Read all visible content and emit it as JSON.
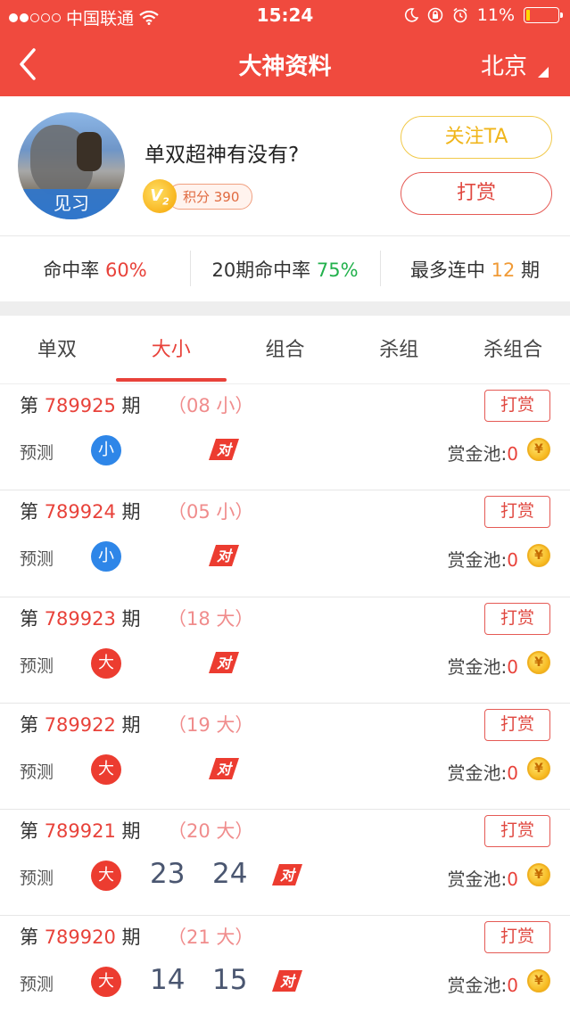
{
  "status_bar": {
    "carrier": "中国联通",
    "time": "15:24",
    "battery": "11%",
    "battery_level": 0.11
  },
  "nav": {
    "title": "大神资料",
    "city": "北京"
  },
  "profile": {
    "level_label": "见习",
    "name": "单双超神有没有?",
    "badge_level": "V",
    "badge_sub": "2",
    "score": "积分 390",
    "follow_label": "关注TA",
    "tip_label": "打赏"
  },
  "stats": [
    {
      "label": "命中率 ",
      "value": "60%",
      "color": "#e8423a"
    },
    {
      "label": "20期命中率 ",
      "value": "75%",
      "color": "#22b14c"
    },
    {
      "label": "最多连中 ",
      "value": "12",
      "suffix": " 期",
      "color": "#f09a35"
    }
  ],
  "tabs": [
    {
      "label": "单双",
      "active": false
    },
    {
      "label": "大小",
      "active": true
    },
    {
      "label": "组合",
      "active": false
    },
    {
      "label": "杀组",
      "active": false
    },
    {
      "label": "杀组合",
      "active": false
    }
  ],
  "rows": [
    {
      "prefix": "第 ",
      "issue": "789925",
      "suffix": " 期",
      "result": "（08   小）",
      "tip": "打赏",
      "pred_label": "预测",
      "ball": "小",
      "ball_color": "blue",
      "nums": [],
      "verdict": "对",
      "pool_label": "赏金池:",
      "pool_value": "0"
    },
    {
      "prefix": "第 ",
      "issue": "789924",
      "suffix": " 期",
      "result": "（05   小）",
      "tip": "打赏",
      "pred_label": "预测",
      "ball": "小",
      "ball_color": "blue",
      "nums": [],
      "verdict": "对",
      "pool_label": "赏金池:",
      "pool_value": "0"
    },
    {
      "prefix": "第 ",
      "issue": "789923",
      "suffix": " 期",
      "result": "（18   大）",
      "tip": "打赏",
      "pred_label": "预测",
      "ball": "大",
      "ball_color": "red",
      "nums": [],
      "verdict": "对",
      "pool_label": "赏金池:",
      "pool_value": "0"
    },
    {
      "prefix": "第 ",
      "issue": "789922",
      "suffix": " 期",
      "result": "（19   大）",
      "tip": "打赏",
      "pred_label": "预测",
      "ball": "大",
      "ball_color": "red",
      "nums": [],
      "verdict": "对",
      "pool_label": "赏金池:",
      "pool_value": "0"
    },
    {
      "prefix": "第 ",
      "issue": "789921",
      "suffix": " 期",
      "result": "（20   大）",
      "tip": "打赏",
      "pred_label": "预测",
      "ball": "大",
      "ball_color": "red",
      "nums": [
        "23",
        "24"
      ],
      "verdict": "对",
      "pool_label": "赏金池:",
      "pool_value": "0"
    },
    {
      "prefix": "第 ",
      "issue": "789920",
      "suffix": " 期",
      "result": "（21   大）",
      "tip": "打赏",
      "pred_label": "预测",
      "ball": "大",
      "ball_color": "red",
      "nums": [
        "14",
        "15"
      ],
      "verdict": "对",
      "pool_label": "赏金池:",
      "pool_value": "0"
    }
  ],
  "coin_symbol": "¥"
}
